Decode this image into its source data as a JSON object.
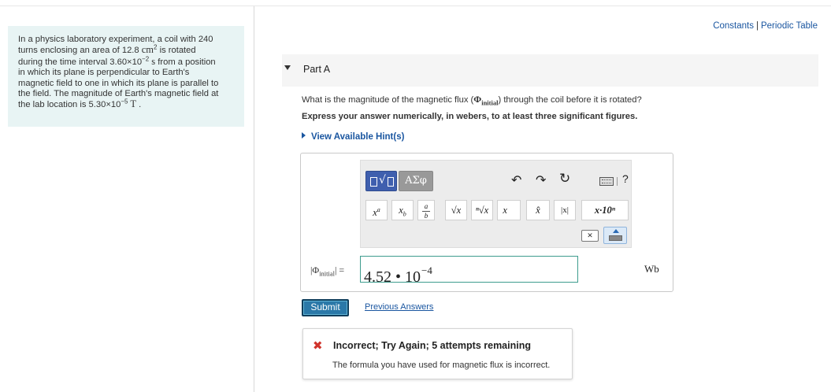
{
  "header": {
    "links": [
      "Constants",
      "Periodic Table"
    ],
    "separator": "|"
  },
  "problem": {
    "line1": "In a physics laboratory experiment, a coil with 240",
    "line2_pre": "turns enclosing an area of 12.8 ",
    "line2_unit": "cm",
    "line2_exp": "2",
    "line2_post": " is rotated",
    "line3_pre": "during the time interval 3.60×10",
    "line3_exp": "−2",
    "line3_unit": " s",
    "line3_post": " from a position",
    "line4": "in which its plane is perpendicular to Earth's",
    "line5": "magnetic field to one in which its plane is parallel to",
    "line6": "the field. The magnitude of Earth's magnetic field at",
    "line7_pre": "the lab location is 5.30×10",
    "line7_exp": "−5",
    "line7_unit": " T",
    "line7_post": " ."
  },
  "part": {
    "title": "Part A",
    "question_pre": "What is the magnitude of the magnetic flux (",
    "question_phi": "Φ",
    "question_sub": "initial",
    "question_post": ") through the coil before it is rotated?",
    "instruction": "Express your answer numerically, in webers, to at least three significant figures.",
    "hints_label": "View Available Hint(s)"
  },
  "toolbar": {
    "greek_label": "ΑΣφ",
    "help_label": "?",
    "keys": {
      "power_base": "x",
      "power_exp": "a",
      "sub_base": "x",
      "sub_sub": "b",
      "fraction_num": "a",
      "fraction_den": "b",
      "sqrt": "√x",
      "nthroot": "ⁿ√x",
      "vector": "x⃗",
      "hat": "x̂",
      "abs": "|x|",
      "sci": "x·10ⁿ"
    }
  },
  "answer": {
    "label_pre": "|",
    "label_phi": "Φ",
    "label_sub": "initial",
    "label_post": "| =",
    "value_mantissa": "4.52 • 10",
    "value_exp": "−4",
    "unit": "Wb"
  },
  "actions": {
    "submit_label": "Submit",
    "previous_answers_label": "Previous Answers"
  },
  "feedback": {
    "status": "Incorrect; Try Again; 5 attempts remaining",
    "message": "The formula you have used for magnetic flux is incorrect.",
    "status_color": "#d0342c"
  },
  "colors": {
    "accent": "#1a56a0",
    "submit_bg": "#2a78a8",
    "problem_bg": "#e8f4f4",
    "input_border": "#3e9c8e"
  }
}
